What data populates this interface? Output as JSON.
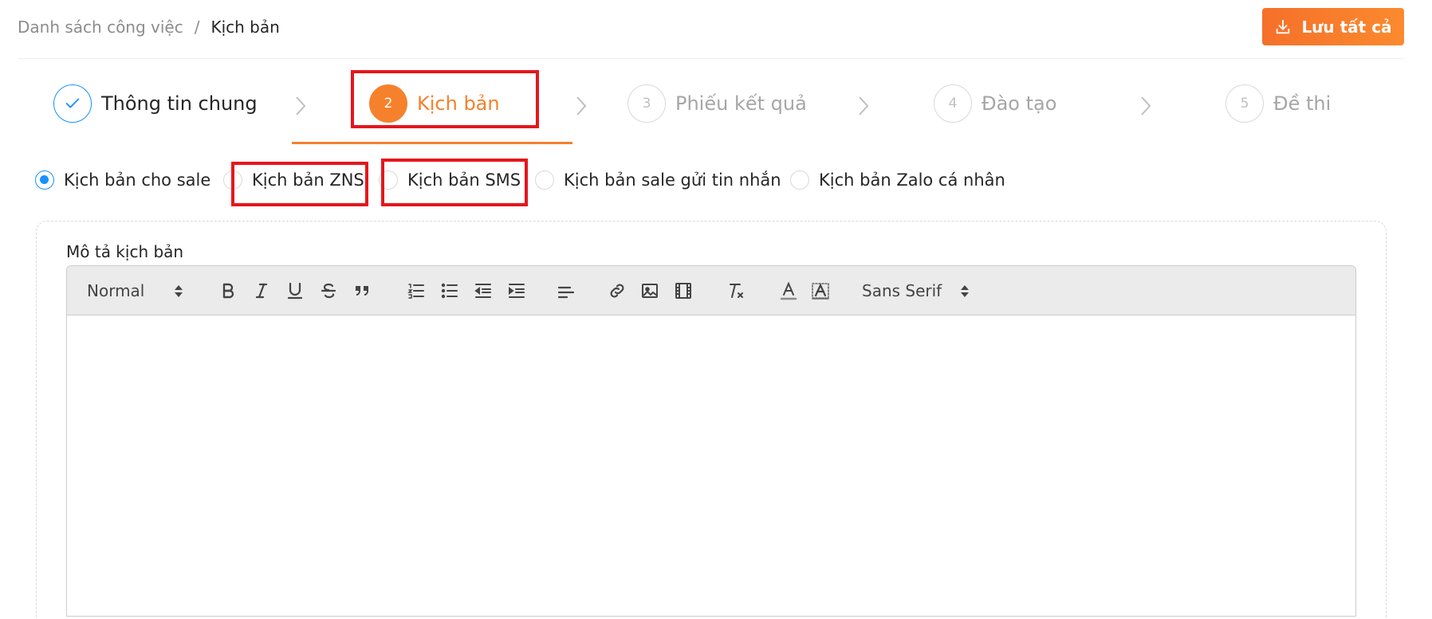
{
  "breadcrumb": {
    "root": "Danh sách công việc",
    "separator": "/",
    "current": "Kịch bản"
  },
  "actions": {
    "save_all": "Lưu tất cả",
    "save_icon": "download-icon"
  },
  "steps": [
    {
      "number": "",
      "label": "Thông tin chung",
      "status": "done",
      "icon": "check-icon"
    },
    {
      "number": "2",
      "label": "Kịch bản",
      "status": "active"
    },
    {
      "number": "3",
      "label": "Phiếu kết quả",
      "status": "pending"
    },
    {
      "number": "4",
      "label": "Đào tạo",
      "status": "pending"
    },
    {
      "number": "5",
      "label": "Đề thi",
      "status": "pending"
    }
  ],
  "script_types": {
    "options": [
      "Kịch bản cho sale",
      "Kịch bản ZNS",
      "Kịch bản SMS",
      "Kịch bản sale gửi tin nhắn",
      "Kịch bản Zalo cá nhân"
    ],
    "selected": "Kịch bản cho sale"
  },
  "editor": {
    "label": "Mô tả kịch bản",
    "header_select": "Normal",
    "font_select": "Sans Serif",
    "content": ""
  },
  "colors": {
    "accent": "#f5812d",
    "primary": "#1890ff",
    "highlight": "#e6161d"
  }
}
